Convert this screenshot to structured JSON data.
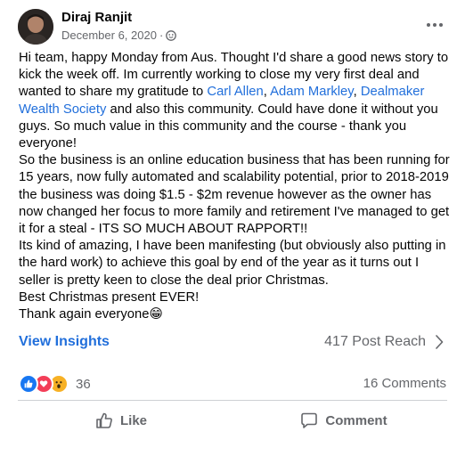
{
  "post": {
    "author": "Diraj Ranjit",
    "date": "December 6, 2020",
    "separator": "·",
    "body": {
      "p1_a": "Hi team, happy Monday from Aus.  Thought I'd share a good news story to kick the week off. Im currently working to close my very first deal and wanted to share my gratitude to ",
      "link1": "Carl Allen",
      "comma": ", ",
      "link2": "Adam Markley",
      "comma2": ", ",
      "link3": "Dealmaker Wealth Society",
      "p1_b": " and also this community. Could have done it without you guys. So much value in this community and the course - thank you everyone!",
      "p2": "So the business is an online education business that has been running for 15 years, now fully automated and scalability potential, prior to 2018-2019 the business was doing $1.5 - $2m revenue however as the owner has now changed her focus to more family and retirement I've managed to get it for a steal - ITS SO MUCH ABOUT RAPPORT!!",
      "p3": "Its kind of amazing, I have been manifesting (but obviously also putting in the hard work) to achieve this goal by end of the year as it turns out I seller is pretty keen to close the deal prior Christmas.",
      "p4": "Best Christmas present EVER!",
      "p5": "Thank again everyone",
      "emoji": "😁"
    }
  },
  "insights": {
    "label": "View Insights",
    "reach": "417 Post Reach"
  },
  "engagement": {
    "reaction_icons": [
      "like-icon",
      "love-icon",
      "wow-icon"
    ],
    "reaction_count": "36",
    "comments": "16 Comments"
  },
  "actions": {
    "like": "Like",
    "comment": "Comment"
  },
  "colors": {
    "link": "#216fdb",
    "muted": "#65676b",
    "like": "#1877f2",
    "love": "#f33e58",
    "wow": "#f7b125"
  }
}
